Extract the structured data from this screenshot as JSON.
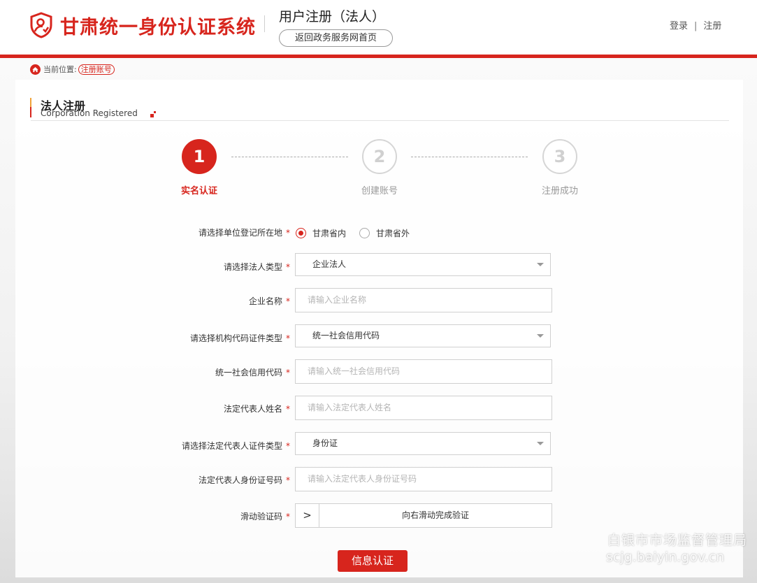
{
  "header": {
    "brand": "甘肃统一身份认证系统",
    "page_title": "用户注册（法人）",
    "back_home_label": "返回政务服务网首页",
    "login_label": "登录",
    "divider": "|",
    "register_label": "注册",
    "logo_icon": "shield-person-icon",
    "accent_color": "#d7251d"
  },
  "breadcrumb": {
    "prefix": "当前位置:",
    "current": "注册账号",
    "icon": "home-icon"
  },
  "section": {
    "title": "法人注册",
    "subtitle": "Corporation Registered"
  },
  "steps": [
    {
      "number": "1",
      "label": "实名认证",
      "state": "active"
    },
    {
      "number": "2",
      "label": "创建账号",
      "state": "inactive"
    },
    {
      "number": "3",
      "label": "注册成功",
      "state": "inactive"
    }
  ],
  "form": {
    "required_mark": "*",
    "location": {
      "label": "请选择单位登记所在地",
      "options": [
        {
          "label": "甘肃省内",
          "selected": true
        },
        {
          "label": "甘肃省外",
          "selected": false
        }
      ]
    },
    "corp_type": {
      "label": "请选择法人类型",
      "value": "企业法人"
    },
    "company_name": {
      "label": "企业名称",
      "placeholder": "请输入企业名称"
    },
    "org_code_type": {
      "label": "请选择机构代码证件类型",
      "value": "统一社会信用代码"
    },
    "credit_code": {
      "label": "统一社会信用代码",
      "placeholder": "请输入统一社会信用代码"
    },
    "legal_rep_name": {
      "label": "法定代表人姓名",
      "placeholder": "请输入法定代表人姓名"
    },
    "legal_rep_id_type": {
      "label": "请选择法定代表人证件类型",
      "value": "身份证"
    },
    "legal_rep_id_number": {
      "label": "法定代表人身份证号码",
      "placeholder": "请输入法定代表人身份证号码"
    },
    "captcha": {
      "label": "滑动验证码",
      "handle": ">",
      "hint": "向右滑动完成验证"
    },
    "submit_label": "信息认证"
  },
  "watermark": {
    "line1": "白银市市场监督管理局",
    "line2": "scjg.baiyin.gov.cn"
  }
}
